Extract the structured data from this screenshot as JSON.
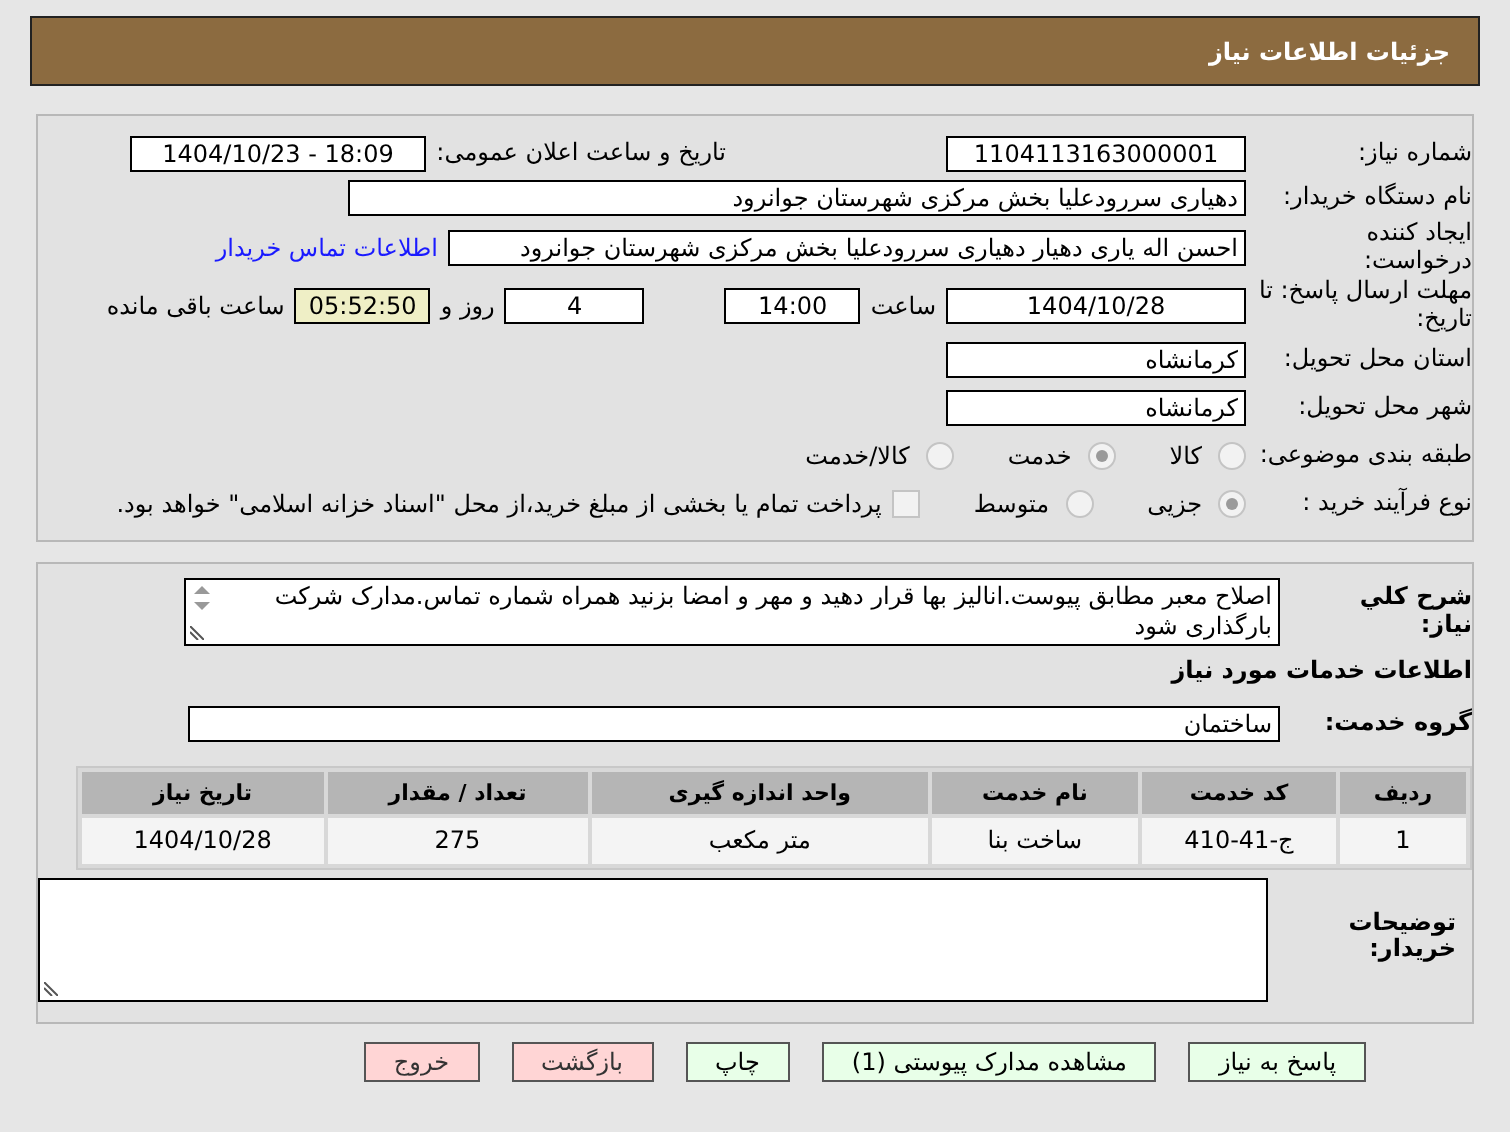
{
  "header": {
    "title": "جزئیات اطلاعات نیاز"
  },
  "need_number": {
    "label": "شماره نیاز:",
    "value": "1104113163000001"
  },
  "announce": {
    "label": "تاریخ و ساعت اعلان عمومی:",
    "value": "1404/10/23 - 18:09"
  },
  "buyer_org": {
    "label": "نام دستگاه خریدار:",
    "value": "دهیاری سررودعلیا بخش مرکزی شهرستان جوانرود"
  },
  "requester": {
    "label": "ایجاد کننده درخواست:",
    "value": "احسن اله یاری دهیار دهیاری سررودعلیا بخش مرکزی شهرستان جوانرود",
    "link": "اطلاعات تماس خریدار"
  },
  "deadline": {
    "label": "مهلت ارسال پاسخ: تا تاریخ:",
    "date": "1404/10/28",
    "time_label": "ساعت",
    "time": "14:00",
    "days": "4",
    "days_label": "روز و",
    "remaining": "05:52:50",
    "remaining_label": "ساعت باقی مانده"
  },
  "province": {
    "label": "استان محل تحویل:",
    "value": "کرمانشاه"
  },
  "city": {
    "label": "شهر محل تحویل:",
    "value": "کرمانشاه"
  },
  "category": {
    "label": "طبقه بندی موضوعی:",
    "options": [
      {
        "label": "کالا",
        "selected": false
      },
      {
        "label": "خدمت",
        "selected": true
      },
      {
        "label": "کالا/خدمت",
        "selected": false
      }
    ]
  },
  "purchase_type": {
    "label": "نوع فرآیند خرید :",
    "options": [
      {
        "label": "جزیی",
        "selected": true
      },
      {
        "label": "متوسط",
        "selected": false
      }
    ],
    "payment": {
      "checked": false,
      "text": "پرداخت تمام یا بخشی از مبلغ خرید،از محل \"اسناد خزانه اسلامی\" خواهد بود."
    }
  },
  "description": {
    "label": "شرح کلي نياز:",
    "value": "اصلاح معبر مطابق پیوست.انالیز بها قرار دهید و مهر و امضا بزنید همراه شماره تماس.مدارک شرکت بارگذاری شود"
  },
  "services_title": "اطلاعات خدمات مورد نیاز",
  "service_group": {
    "label": "گروه خدمت:",
    "value": "ساختمان"
  },
  "table": {
    "columns": [
      "ردیف",
      "کد خدمت",
      "نام خدمت",
      "واحد اندازه گیری",
      "تعداد / مقدار",
      "تاریخ نیاز"
    ],
    "rows": [
      [
        "1",
        "ج-41-410",
        "ساخت بنا",
        "متر مکعب",
        "275",
        "1404/10/28"
      ]
    ]
  },
  "buyer_notes": {
    "label": "توضیحات خریدار:"
  },
  "buttons": [
    {
      "label": "پاسخ به نیاز",
      "kind": "green"
    },
    {
      "label": "مشاهده مدارک پیوستی (1)",
      "kind": "green"
    },
    {
      "label": "چاپ",
      "kind": "green"
    },
    {
      "label": "بازگشت",
      "kind": "red"
    },
    {
      "label": "خروج",
      "kind": "red"
    }
  ]
}
